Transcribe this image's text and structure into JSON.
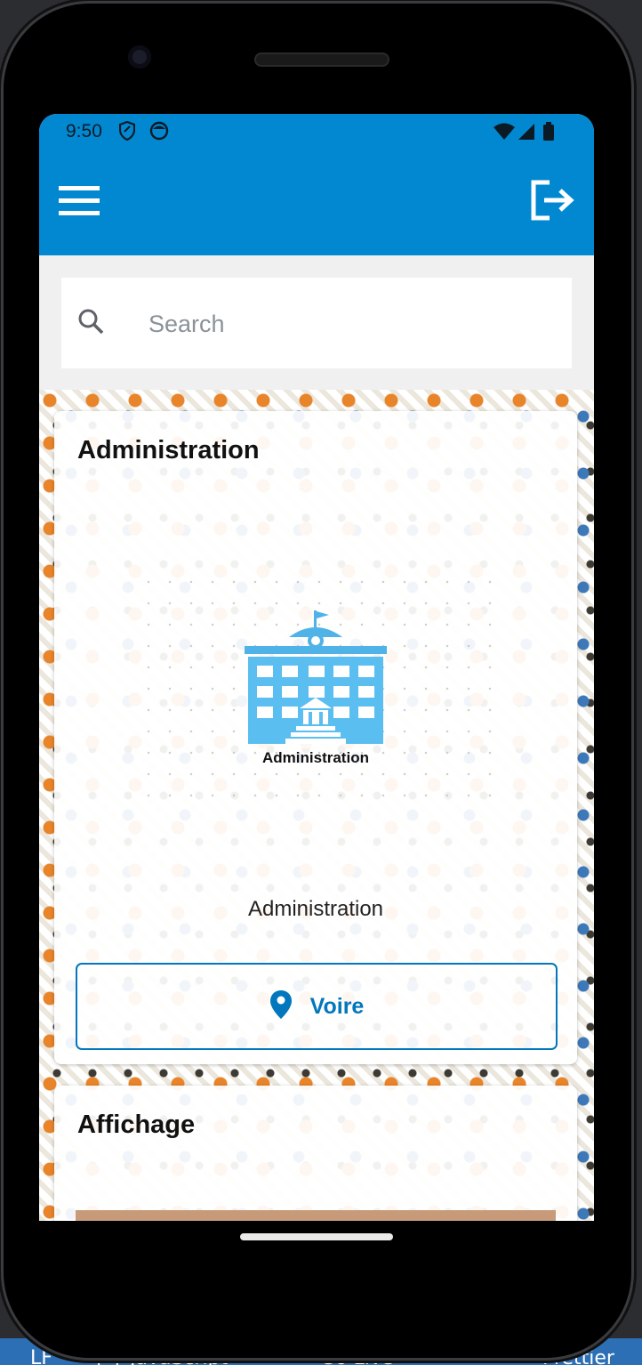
{
  "status_bar": {
    "time": "9:50",
    "icons": [
      "shield-icon",
      "face-icon",
      "wifi-icon",
      "signal-icon",
      "battery-icon"
    ]
  },
  "app_bar": {
    "color": "#0288d1",
    "menu_icon": "hamburger-menu-icon",
    "logout_icon": "logout-icon"
  },
  "search": {
    "placeholder": "Search",
    "value": ""
  },
  "cards": [
    {
      "title": "Administration",
      "image_label": "Administration",
      "caption": "Administration",
      "button_label": "Voire",
      "button_icon": "map-pin-icon"
    },
    {
      "title": "Affichage"
    }
  ],
  "ide_status": {
    "items": [
      "LF",
      "{ } JavaScript",
      "Go Live",
      "Prettier"
    ]
  }
}
